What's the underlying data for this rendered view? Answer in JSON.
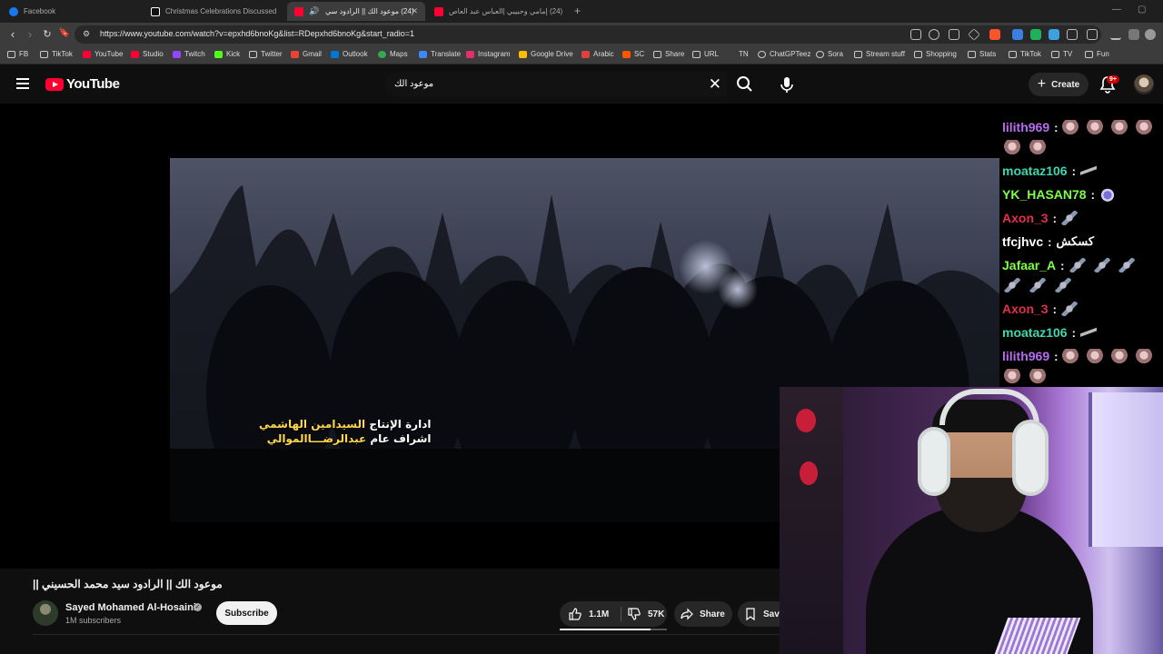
{
  "browser": {
    "tabs": [
      {
        "title": "Facebook",
        "active": false,
        "favicon_color": "#1877f2"
      },
      {
        "title": "Christmas Celebrations Discussed in",
        "active": false,
        "favicon_color": "#ffffff"
      },
      {
        "title": "(24) موعود الك || الرادود سي",
        "active": true,
        "favicon_color": "#ff0033"
      },
      {
        "title": "(24) إمامي وحبيبي |العباس عبد العاص",
        "active": false,
        "favicon_color": "#ff0033"
      }
    ],
    "new_tab_symbol": "+",
    "url": "https://www.youtube.com/watch?v=epxhd6bnoKg&list=RDepxhd6bnoKg&start_radio=1",
    "bookmarks": [
      "FB",
      "TikTok",
      "YouTube",
      "Studio",
      "Twitch",
      "Kick",
      "Twitter",
      "Gmail",
      "Outlook",
      "Maps",
      "Translate",
      "Instagram",
      "Google Drive",
      "Arabic",
      "SC",
      "Share",
      "URL",
      "TN",
      "ChatGPTeez",
      "Sora",
      "Stream stuff",
      "Shopping",
      "Stats",
      "TikTok",
      "TV",
      "Fun"
    ]
  },
  "youtube": {
    "logo_text": "YouTube",
    "search_query": "موعود الك",
    "create_label": "Create",
    "notifications_badge": "9+"
  },
  "video": {
    "credits_line1_label": "ادارة الإنتاج",
    "credits_line1_name": "السيدامين الهاشمي",
    "credits_line2_label": "اشراف عام",
    "credits_line2_name": "عبدالرضـــاالموالي",
    "title": "موعود الك || الرادود سيد محمد الحسيني ||",
    "channel_name": "Sayed Mohamed Al-Hosaini",
    "subscribers": "1M subscribers",
    "subscribe_label": "Subscribe",
    "likes": "1.1M",
    "dislikes": "57K",
    "share_label": "Share",
    "save_label": "Save"
  },
  "chat": {
    "messages": [
      {
        "user": "lilith969",
        "color": "#b86cf0",
        "text": "",
        "emotes": [
          "face",
          "face",
          "face",
          "face",
          "face",
          "face"
        ]
      },
      {
        "user": "moataz106",
        "color": "#3fd7b0",
        "text": "",
        "emotes": [
          "gun"
        ]
      },
      {
        "user": "YK_HASAN78",
        "color": "#7dff45",
        "text": "",
        "emotes": [
          "cat"
        ]
      },
      {
        "user": "Axon_3",
        "color": "#e0304a",
        "text": "",
        "emotes": [
          "rocket"
        ]
      },
      {
        "user": "tfcjhvc",
        "color": "#ffffff",
        "text": "كسكش",
        "emotes": []
      },
      {
        "user": "Jafaar_A",
        "color": "#7dff45",
        "text": "",
        "emotes": [
          "rocket",
          "rocket",
          "rocket",
          "rocket",
          "rocket",
          "rocket"
        ]
      },
      {
        "user": "Axon_3",
        "color": "#e0304a",
        "text": "",
        "emotes": [
          "rocket"
        ]
      },
      {
        "user": "moataz106",
        "color": "#3fd7b0",
        "text": "",
        "emotes": [
          "gun"
        ]
      },
      {
        "user": "lilith969",
        "color": "#b86cf0",
        "text": "",
        "emotes": [
          "face",
          "face",
          "face",
          "face",
          "face",
          "face"
        ]
      }
    ]
  }
}
